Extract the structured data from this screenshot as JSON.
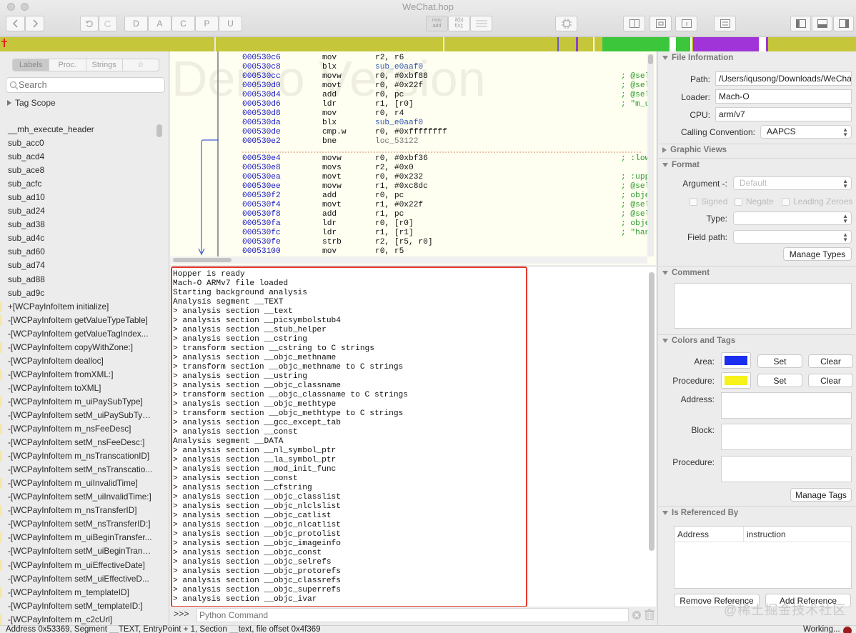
{
  "window": {
    "title": "WeChat.hop"
  },
  "toolbar": {
    "letters": [
      "D",
      "A",
      "C",
      "P",
      "U"
    ],
    "mode_top": "mov",
    "mode_bottom": "add",
    "pseudo_top": "if(b)",
    "pseudo_bottom": "f(x);"
  },
  "sidebar": {
    "tabs": [
      "Labels",
      "Proc.",
      "Strings",
      "☆"
    ],
    "search_placeholder": "Search",
    "tag_scope": "Tag Scope",
    "items": [
      "__mh_execute_header",
      "sub_acc0",
      "sub_acd4",
      "sub_ace8",
      "sub_acfc",
      "sub_ad10",
      "sub_ad24",
      "sub_ad38",
      "sub_ad4c",
      "sub_ad60",
      "sub_ad74",
      "sub_ad88",
      "sub_ad9c",
      "+[WCPayInfoItem initialize]",
      "-[WCPayInfoItem getValueTypeTable]",
      "-[WCPayInfoItem getValueTagIndex...",
      "-[WCPayInfoItem copyWithZone:]",
      "-[WCPayInfoItem dealloc]",
      "-[WCPayInfoItem fromXML:]",
      "-[WCPayInfoItem toXML]",
      "-[WCPayInfoItem m_uiPaySubType]",
      "-[WCPayInfoItem setM_uiPaySubTyp...",
      "-[WCPayInfoItem m_nsFeeDesc]",
      "-[WCPayInfoItem setM_nsFeeDesc:]",
      "-[WCPayInfoItem m_nsTranscationID]",
      "-[WCPayInfoItem setM_nsTranscatio...",
      "-[WCPayInfoItem m_uiInvalidTime]",
      "-[WCPayInfoItem setM_uiInvalidTime:]",
      "-[WCPayInfoItem m_nsTransferID]",
      "-[WCPayInfoItem setM_nsTransferID:]",
      "-[WCPayInfoItem m_uiBeginTransfer...",
      "-[WCPayInfoItem setM_uiBeginTrans...",
      "-[WCPayInfoItem m_uiEffectiveDate]",
      "-[WCPayInfoItem setM_uiEffectiveD...",
      "-[WCPayInfoItem m_templateID]",
      "-[WCPayInfoItem setM_templateID:]",
      "-[WCPayInfoItem m_c2cUrl]"
    ]
  },
  "disasm": {
    "watermark": "Demo Version",
    "rows": [
      {
        "addr": "000530c6",
        "mn": "mov",
        "op": "r2, r6",
        "cm": ""
      },
      {
        "addr": "000530c8",
        "mn": "blx",
        "op": "sub_e0aaf0",
        "cm": ""
      },
      {
        "addr": "000530cc",
        "mn": "movw",
        "op": "r0, #0xbf88",
        "cm": "; @sel"
      },
      {
        "addr": "000530d0",
        "mn": "movt",
        "op": "r0, #0x22f",
        "cm": "; @sel"
      },
      {
        "addr": "000530d4",
        "mn": "add",
        "op": "r0, pc",
        "cm": "; @sel"
      },
      {
        "addr": "000530d6",
        "mn": "ldr",
        "op": "r1, [r0]",
        "cm": "; \"m_u"
      },
      {
        "addr": "000530d8",
        "mn": "mov",
        "op": "r0, r4",
        "cm": ""
      },
      {
        "addr": "000530da",
        "mn": "blx",
        "op": "sub_e0aaf0",
        "cm": ""
      },
      {
        "addr": "000530de",
        "mn": "cmp.w",
        "op": "r0, #0xffffffff",
        "cm": ""
      },
      {
        "addr": "000530e2",
        "mn": "bne",
        "op": "loc_53122",
        "cm": ""
      },
      {
        "addr": "000530e4",
        "mn": "movw",
        "op": "r0, #0xbf36",
        "cm": "; :low"
      },
      {
        "addr": "000530e8",
        "mn": "movs",
        "op": "r2, #0x0",
        "cm": ""
      },
      {
        "addr": "000530ea",
        "mn": "movt",
        "op": "r0, #0x232",
        "cm": "; :upp"
      },
      {
        "addr": "000530ee",
        "mn": "movw",
        "op": "r1, #0xc8dc",
        "cm": "; @sel"
      },
      {
        "addr": "000530f2",
        "mn": "add",
        "op": "r0, pc",
        "cm": "; obje"
      },
      {
        "addr": "000530f4",
        "mn": "movt",
        "op": "r1, #0x22f",
        "cm": "; @sel"
      },
      {
        "addr": "000530f8",
        "mn": "add",
        "op": "r1, pc",
        "cm": "; @sel"
      },
      {
        "addr": "000530fa",
        "mn": "ldr",
        "op": "r0, [r0]",
        "cm": "; obje"
      },
      {
        "addr": "000530fc",
        "mn": "ldr",
        "op": "r1, [r1]",
        "cm": "; \"han"
      },
      {
        "addr": "000530fe",
        "mn": "strb",
        "op": "r2, [r5, r0]",
        "cm": ""
      },
      {
        "addr": "00053100",
        "mn": "mov",
        "op": "r0, r5",
        "cm": ""
      }
    ]
  },
  "console": {
    "lines": [
      "Hopper is ready",
      "Mach-O ARMv7 file loaded",
      "Starting background analysis",
      "Analysis segment __TEXT",
      "> analysis section __text",
      "> analysis section __picsymbolstub4",
      "> analysis section __stub_helper",
      "> analysis section __cstring",
      "> transform section __cstring to C strings",
      "> analysis section __objc_methname",
      "> transform section __objc_methname to C strings",
      "> analysis section __ustring",
      "> analysis section __objc_classname",
      "> transform section __objc_classname to C strings",
      "> analysis section __objc_methtype",
      "> transform section __objc_methtype to C strings",
      "> analysis section __gcc_except_tab",
      "> analysis section __const",
      "Analysis segment __DATA",
      "> analysis section __nl_symbol_ptr",
      "> analysis section __la_symbol_ptr",
      "> analysis section __mod_init_func",
      "> analysis section __const",
      "> analysis section __cfstring",
      "> analysis section __objc_classlist",
      "> analysis section __objc_nlclslist",
      "> analysis section __objc_catlist",
      "> analysis section __objc_nlcatlist",
      "> analysis section __objc_protolist",
      "> analysis section __objc_imageinfo",
      "> analysis section __objc_const",
      "> analysis section __objc_selrefs",
      "> analysis section __objc_protorefs",
      "> analysis section __objc_classrefs",
      "> analysis section __objc_superrefs",
      "> analysis section __objc_ivar"
    ],
    "prompt": ">>>",
    "input_placeholder": "Python Command"
  },
  "inspector": {
    "file_info": {
      "title": "File Information",
      "path_label": "Path:",
      "path": "/Users/iqusong/Downloads/WeChat",
      "loader_label": "Loader:",
      "loader": "Mach-O",
      "cpu_label": "CPU:",
      "cpu": "arm/v7",
      "cc_label": "Calling Convention:",
      "cc": "AAPCS"
    },
    "graphic_views": "Graphic Views",
    "format": {
      "title": "Format",
      "argument_label": "Argument -:",
      "argument": "Default",
      "signed": "Signed",
      "negate": "Negate",
      "leading_zeroes": "Leading Zeroes",
      "type_label": "Type:",
      "field_label": "Field path:",
      "manage_types": "Manage Types"
    },
    "comment": {
      "title": "Comment"
    },
    "colors_tags": {
      "title": "Colors and Tags",
      "area_label": "Area:",
      "area_color": "#1a2ff0",
      "procedure_label": "Procedure:",
      "procedure_color": "#f6f21a",
      "set": "Set",
      "clear": "Clear",
      "address_label": "Address:",
      "block_label": "Block:",
      "procedure2_label": "Procedure:",
      "manage_tags": "Manage Tags"
    },
    "references": {
      "title": "Is Referenced By",
      "col_address": "Address",
      "col_instruction": "instruction",
      "remove": "Remove Reference",
      "add": "Add Reference"
    }
  },
  "status": {
    "text": "Address 0x53369, Segment __TEXT, EntryPoint + 1, Section __text, file offset 0x4f369",
    "right": "Working..."
  },
  "watermark_site": "@稀土掘金技术社区",
  "colors": {
    "nav_band": "#c6c63a",
    "console_border": "#e4392c",
    "disasm_bg": "#fffff1"
  }
}
